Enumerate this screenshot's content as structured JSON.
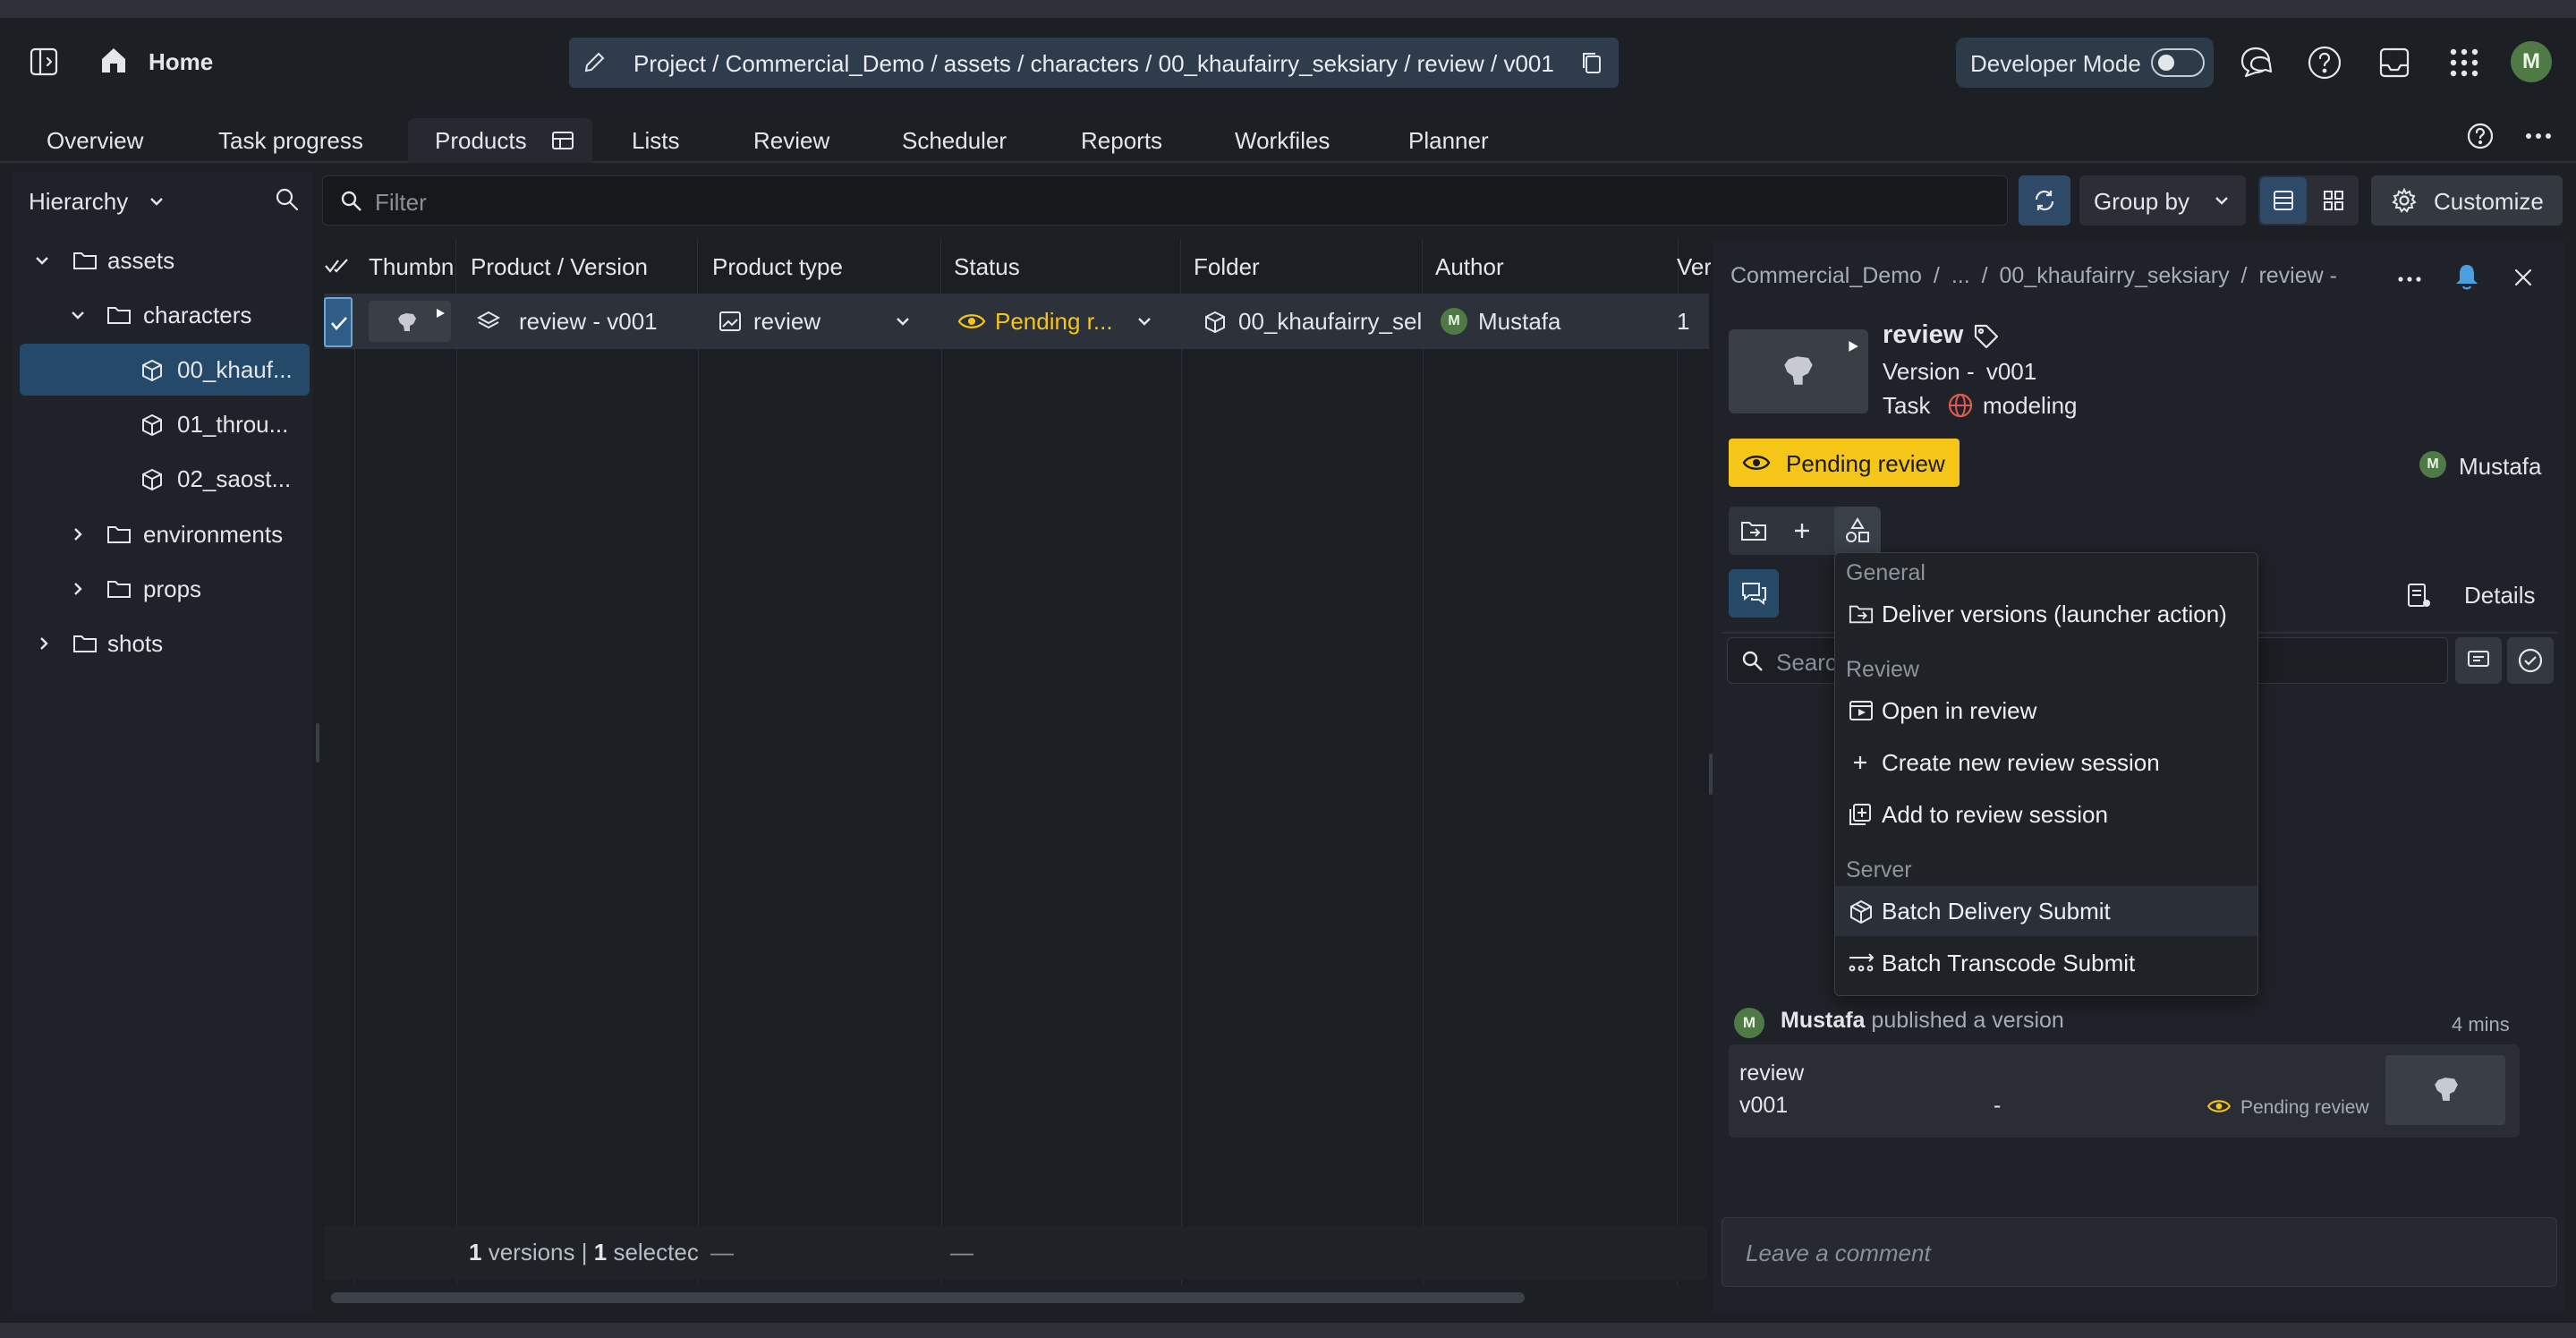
{
  "header": {
    "home_label": "Home",
    "breadcrumb": "Project / Commercial_Demo / assets / characters / 00_khaufairry_seksiary / review / v001",
    "dev_mode_label": "Developer Mode",
    "user_initial": "M"
  },
  "tabs": [
    {
      "label": "Overview"
    },
    {
      "label": "Task progress"
    },
    {
      "label": "Products"
    },
    {
      "label": "Lists"
    },
    {
      "label": "Review"
    },
    {
      "label": "Scheduler"
    },
    {
      "label": "Reports"
    },
    {
      "label": "Workfiles"
    },
    {
      "label": "Planner"
    }
  ],
  "sidebar": {
    "title": "Hierarchy",
    "tree": [
      {
        "label": "assets"
      },
      {
        "label": "characters"
      },
      {
        "label": "00_khauf..."
      },
      {
        "label": "01_throu..."
      },
      {
        "label": "02_saost..."
      },
      {
        "label": "environments"
      },
      {
        "label": "props"
      },
      {
        "label": "shots"
      }
    ]
  },
  "toolbar": {
    "filter_placeholder": "Filter",
    "group_by_label": "Group by",
    "customize_label": "Customize"
  },
  "table": {
    "columns": [
      "Thumbn",
      "Product / Version",
      "Product type",
      "Status",
      "Folder",
      "Author",
      "Ver"
    ],
    "rows": [
      {
        "product_version": "review - v001",
        "product_type": "review",
        "status": "Pending r...",
        "folder": "00_khaufairry_sel",
        "author": "Mustafa",
        "author_initial": "M",
        "version": "1"
      }
    ],
    "footer": {
      "count": "1",
      "count_label": "versions |",
      "selected": "1",
      "selected_label": "selectec",
      "dash1": "—",
      "dash2": "—"
    }
  },
  "details": {
    "breadcrumb": {
      "project": "Commercial_Demo",
      "sep1": "/",
      "ellipsis": "...",
      "sep2": "/",
      "folder": "00_khaufairry_seksiary",
      "sep3": "/",
      "product": "review -"
    },
    "title": "review",
    "version_label": "Version -",
    "version_value": "v001",
    "task_label": "Task",
    "task_value": "modeling",
    "status": "Pending review",
    "assignee": "Mustafa",
    "assignee_initial": "M",
    "details_label": "Details",
    "search_placeholder": "Search",
    "activity": {
      "user": "Mustafa",
      "user_initial": "M",
      "action": "published a version",
      "time": "4 mins",
      "card_product": "review",
      "card_version": "v001",
      "card_dash": "-",
      "card_status": "Pending review"
    },
    "comment_placeholder": "Leave a comment"
  },
  "menu": {
    "sections": [
      {
        "title": "General",
        "items": [
          {
            "label": "Deliver versions (launcher action)"
          }
        ]
      },
      {
        "title": "Review",
        "items": [
          {
            "label": "Open in review"
          },
          {
            "label": "Create new review session"
          },
          {
            "label": "Add to review session"
          }
        ]
      },
      {
        "title": "Server",
        "items": [
          {
            "label": "Batch Delivery Submit"
          },
          {
            "label": "Batch Transcode Submit"
          }
        ]
      }
    ]
  },
  "colors": {
    "accent": "#f5c518",
    "selection": "#254a69",
    "breadcrumb_bg": "#2e3c4c"
  }
}
